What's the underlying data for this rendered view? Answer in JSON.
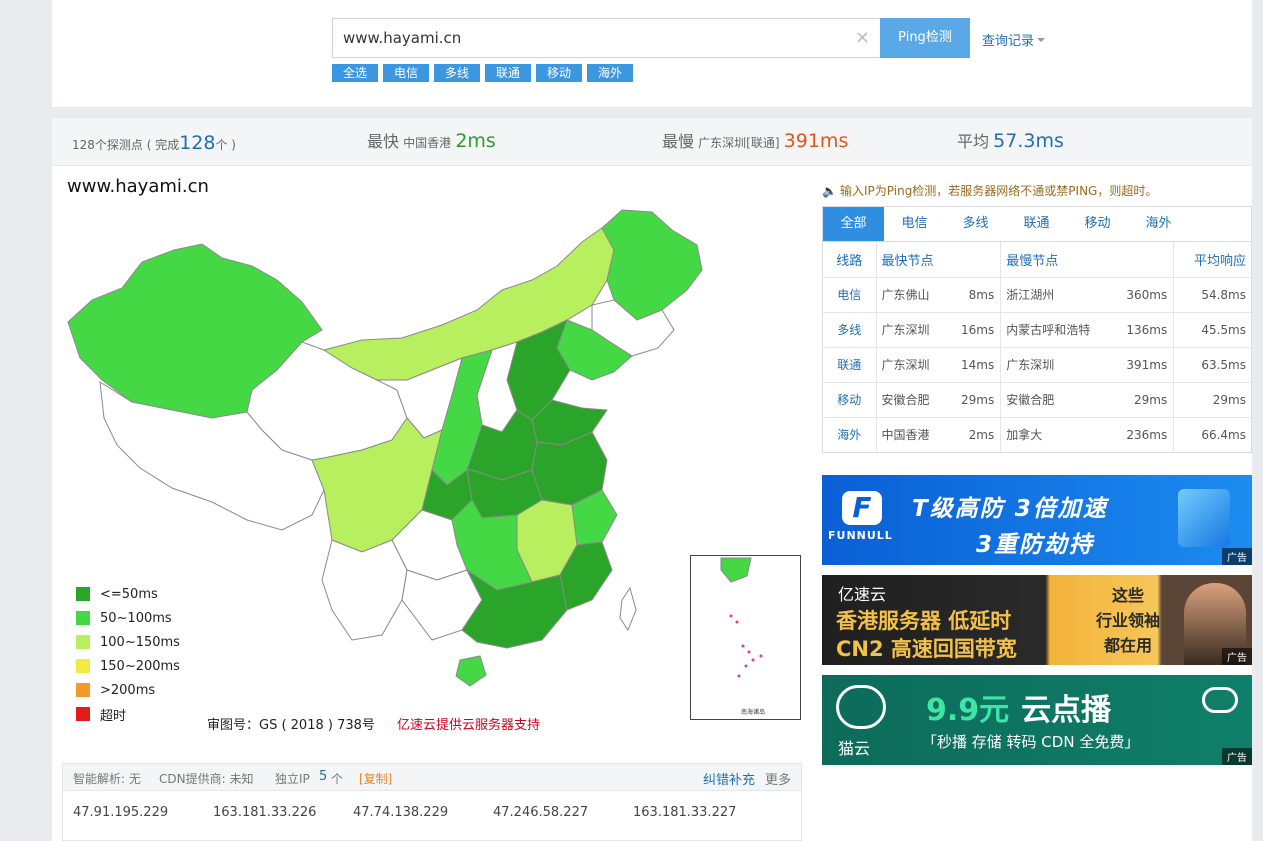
{
  "search": {
    "value": "www.hayami.cn",
    "clear_icon": "×",
    "button_label": "Ping检测",
    "history_label": "查询记录"
  },
  "filters": [
    "全选",
    "电信",
    "多线",
    "联通",
    "移动",
    "海外"
  ],
  "stats": {
    "probe_prefix": "128个探测点 ( 完成",
    "probe_done": "128",
    "probe_suffix": "个 )",
    "fastest_label": "最快",
    "fastest_location": "中国香港",
    "fastest_value": "2ms",
    "slowest_label": "最慢",
    "slowest_location": "广东深圳[联通]",
    "slowest_value": "391ms",
    "avg_label": "平均",
    "avg_value": "57.3ms"
  },
  "map": {
    "title": "www.hayami.cn",
    "caption": "审图号：GS ( 2018 ) 738号",
    "credit": "亿速云提供云服务器支持",
    "inset_label": "南海诸岛",
    "legend": [
      {
        "label": "<=50ms",
        "color": "#2aa52a"
      },
      {
        "label": "50~100ms",
        "color": "#45d845"
      },
      {
        "label": "100~150ms",
        "color": "#b7ef5f"
      },
      {
        "label": "150~200ms",
        "color": "#f4ea45"
      },
      {
        "label": ">200ms",
        "color": "#f39a2c"
      },
      {
        "label": "超时",
        "color": "#e21b1b"
      }
    ]
  },
  "dns": {
    "smart": "智能解析: 无",
    "cdn": "CDN提供商: 未知",
    "ip_label": "独立IP",
    "ip_count": "5",
    "ip_unit": "个",
    "copy": "[复制]",
    "report": "纠错补充",
    "more": "更多",
    "ips": [
      "47.91.195.229",
      "163.181.33.226",
      "47.74.138.229",
      "47.246.58.227",
      "163.181.33.227"
    ]
  },
  "notice": "输入IP为Ping检测，若服务器网络不通或禁PING，则超时。",
  "tabs": [
    "全部",
    "电信",
    "多线",
    "联通",
    "移动",
    "海外"
  ],
  "table": {
    "headers": [
      "线路",
      "最快节点",
      "最慢节点",
      "平均响应"
    ],
    "rows": [
      {
        "line": "电信",
        "fast": "广东佛山",
        "fast_t": "8ms",
        "slow": "浙江湖州",
        "slow_t": "360ms",
        "avg": "54.8ms"
      },
      {
        "line": "多线",
        "fast": "广东深圳",
        "fast_t": "16ms",
        "slow": "内蒙古呼和浩特",
        "slow_t": "136ms",
        "avg": "45.5ms"
      },
      {
        "line": "联通",
        "fast": "广东深圳",
        "fast_t": "14ms",
        "slow": "广东深圳",
        "slow_t": "391ms",
        "avg": "63.5ms"
      },
      {
        "line": "移动",
        "fast": "安徽合肥",
        "fast_t": "29ms",
        "slow": "安徽合肥",
        "slow_t": "29ms",
        "avg": "29ms"
      },
      {
        "line": "海外",
        "fast": "中国香港",
        "fast_t": "2ms",
        "slow": "加拿大",
        "slow_t": "236ms",
        "avg": "66.4ms"
      }
    ]
  },
  "ads": {
    "tag": "广告",
    "ad1": {
      "brand": "FUNNULL",
      "logo": "F",
      "line1": "T级高防  3倍加速",
      "line2": "3重防劫持"
    },
    "ad2": {
      "brand": "亿速云",
      "line1": "香港服务器 低延时",
      "line2": "CN2 高速回国带宽",
      "side": "这些\n行业领袖\n都在用"
    },
    "ad3": {
      "brand": "猫云",
      "price": "9.9元",
      "product": "云点播",
      "line2": "「秒播 存储 转码 CDN 全免费」"
    }
  }
}
